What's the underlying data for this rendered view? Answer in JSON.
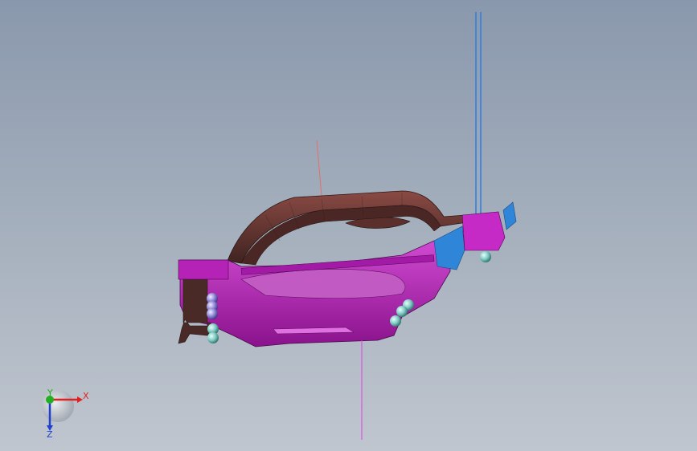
{
  "viewport": {
    "background_top": "#8a98ad",
    "background_bottom": "#c0c6cf"
  },
  "model": {
    "colors": {
      "brown_top": "#6a3a36",
      "brown_dark": "#3f2320",
      "magenta": "#b21fb5",
      "magenta_light": "#d84fd8",
      "blue": "#2f86d8",
      "sphere_teal": "#7fc9c2",
      "sphere_violet": "#8f86d6"
    }
  },
  "guides": {
    "red_line_color": "#e07070",
    "blue_line_color": "#2b7fe0",
    "magenta_line_color": "#e040e0"
  },
  "triad": {
    "x_label": "X",
    "y_label": "Y",
    "z_label": "Z",
    "x_color": "#e02020",
    "y_color": "#20b020",
    "z_color": "#2040d0"
  }
}
